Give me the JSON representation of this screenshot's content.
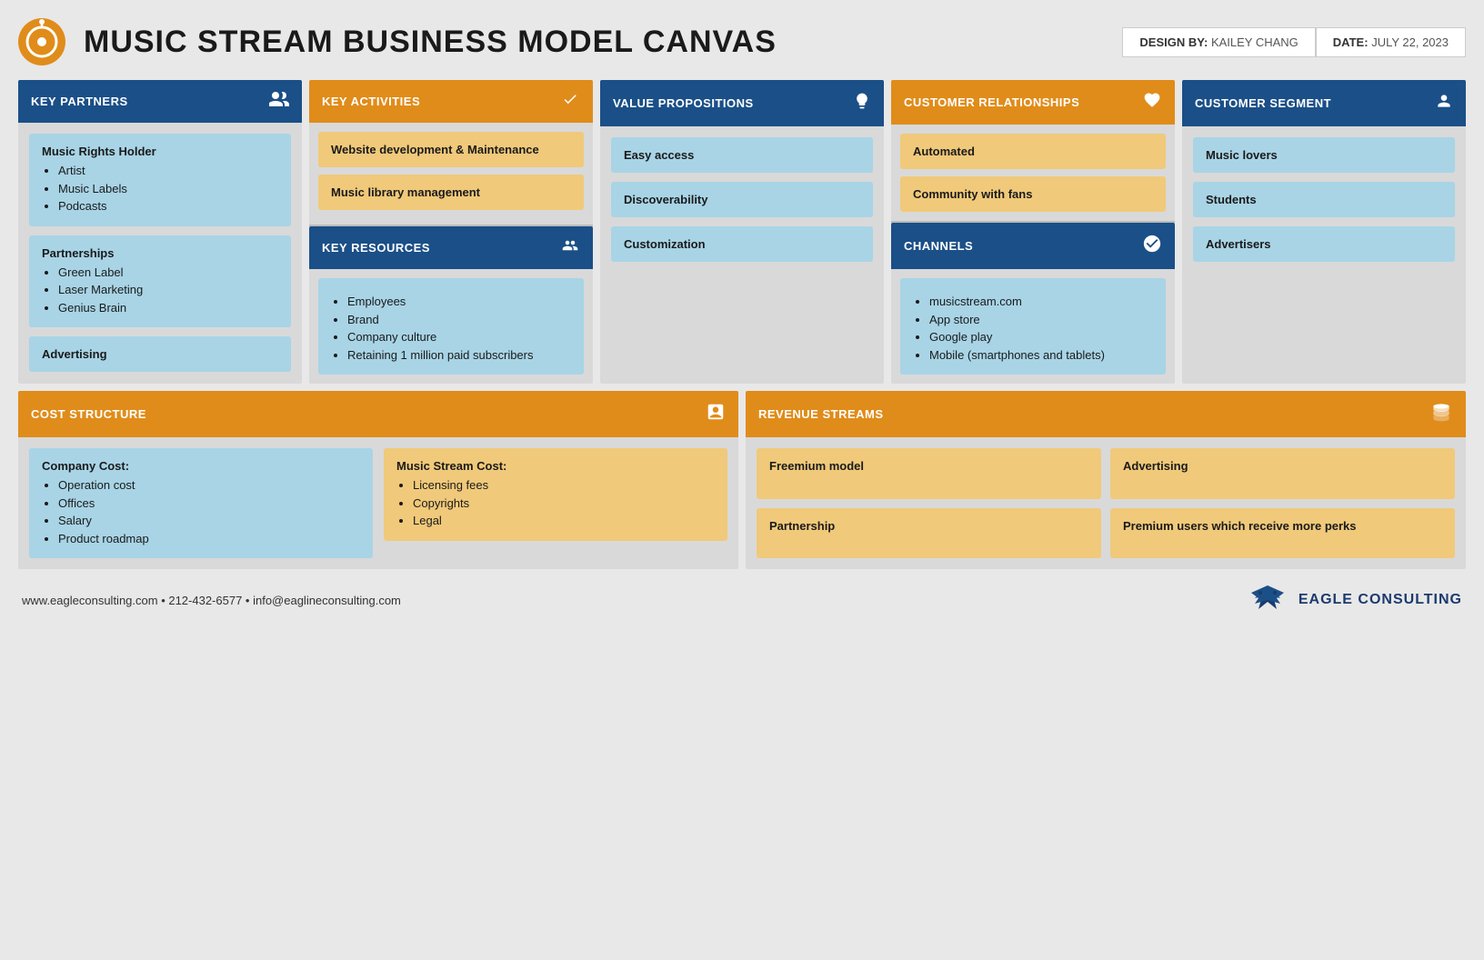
{
  "header": {
    "title": "MUSIC STREAM BUSINESS MODEL CANVAS",
    "design_label": "DESIGN BY:",
    "design_value": "KAILEY CHANG",
    "date_label": "DATE:",
    "date_value": "JULY 22, 2023"
  },
  "sections": {
    "key_partners": {
      "title": "KEY PARTNERS",
      "icon": "🤝",
      "cards": [
        {
          "type": "blue",
          "title": "Music Rights Holder",
          "items": [
            "Artist",
            "Music Labels",
            "Podcasts"
          ]
        },
        {
          "type": "blue",
          "title": "Partnerships",
          "items": [
            "Green Label",
            "Laser Marketing",
            "Genius Brain"
          ]
        },
        {
          "type": "blue",
          "title": "Advertising",
          "items": []
        }
      ]
    },
    "key_activities": {
      "title": "KEY ACTIVITIES",
      "icon": "✔",
      "cards": [
        {
          "type": "orange",
          "title": "Website development & Maintenance",
          "items": []
        },
        {
          "type": "orange",
          "title": "Music library management",
          "items": []
        }
      ]
    },
    "key_resources": {
      "title": "KEY RESOURCES",
      "icon": "👥",
      "cards": [
        {
          "type": "blue",
          "title": "",
          "items": [
            "Employees",
            "Brand",
            "Company culture",
            "Retaining 1 million paid subscribers"
          ]
        }
      ]
    },
    "value_propositions": {
      "title": "VALUE PROPOSITIONS",
      "icon": "💡",
      "cards": [
        {
          "type": "blue",
          "title": "Easy access",
          "items": []
        },
        {
          "type": "blue",
          "title": "Discoverability",
          "items": []
        },
        {
          "type": "blue",
          "title": "Customization",
          "items": []
        }
      ]
    },
    "customer_relationships": {
      "title": "CUSTOMER RELATIONSHIPS",
      "icon": "♥",
      "cards": [
        {
          "type": "orange",
          "title": "Automated",
          "items": []
        },
        {
          "type": "orange",
          "title": "Community with fans",
          "items": []
        }
      ]
    },
    "channels": {
      "title": "CHANNELS",
      "icon": "✦",
      "cards": [
        {
          "type": "blue",
          "title": "",
          "items": [
            "musicstream.com",
            "App store",
            "Google play",
            "Mobile (smartphones and tablets)"
          ]
        }
      ]
    },
    "customer_segment": {
      "title": "CUSTOMER SEGMENT",
      "icon": "👤",
      "cards": [
        {
          "type": "blue",
          "title": "Music lovers",
          "items": []
        },
        {
          "type": "blue",
          "title": "Students",
          "items": []
        },
        {
          "type": "blue",
          "title": "Advertisers",
          "items": []
        }
      ]
    },
    "cost_structure": {
      "title": "COST STRUCTURE",
      "icon": "🧮",
      "groups": [
        {
          "type": "blue",
          "title": "Company Cost:",
          "items": [
            "Operation cost",
            "Offices",
            "Salary",
            "Product roadmap"
          ]
        },
        {
          "type": "orange",
          "title": "Music Stream Cost:",
          "items": [
            "Licensing fees",
            "Copyrights",
            "Legal"
          ]
        }
      ]
    },
    "revenue_streams": {
      "title": "REVENUE STREAMS",
      "icon": "💰",
      "groups": [
        {
          "type": "orange",
          "title": "Freemium model",
          "items": []
        },
        {
          "type": "orange",
          "title": "Partnership",
          "items": []
        },
        {
          "type": "orange",
          "title": "Advertising",
          "items": []
        },
        {
          "type": "orange",
          "title": "Premium users which receive more perks",
          "items": []
        }
      ]
    }
  },
  "footer": {
    "contact": "www.eagleconsulting.com  •  212-432-6577  •  info@eaglineconsulting.com",
    "brand": "EAGLE CONSULTING"
  }
}
